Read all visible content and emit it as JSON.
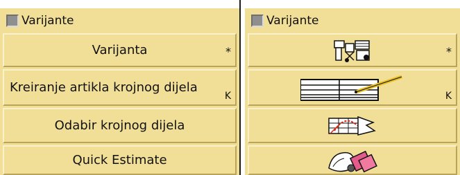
{
  "left_panel": {
    "header_label": "Varijante",
    "buttons": [
      {
        "label": "Varijanta",
        "shortcut": "*"
      },
      {
        "label": "Kreiranje artikla krojnog dijela",
        "shortcut": "K"
      },
      {
        "label": "Odabir krojnog dijela",
        "shortcut": ""
      },
      {
        "label": "Quick Estimate",
        "shortcut": ""
      }
    ]
  },
  "right_panel": {
    "header_label": "Varijante",
    "buttons": [
      {
        "icon": "variant-machine-icon",
        "shortcut": "*"
      },
      {
        "icon": "table-grid-pencil-icon",
        "shortcut": "K"
      },
      {
        "icon": "cut-part-select-icon",
        "shortcut": ""
      },
      {
        "icon": "quick-estimate-icon",
        "shortcut": ""
      }
    ]
  },
  "colors": {
    "panel_bg": "#f1df98",
    "checkbox": "#8f8f8f",
    "divider": "#1a1a1a"
  }
}
